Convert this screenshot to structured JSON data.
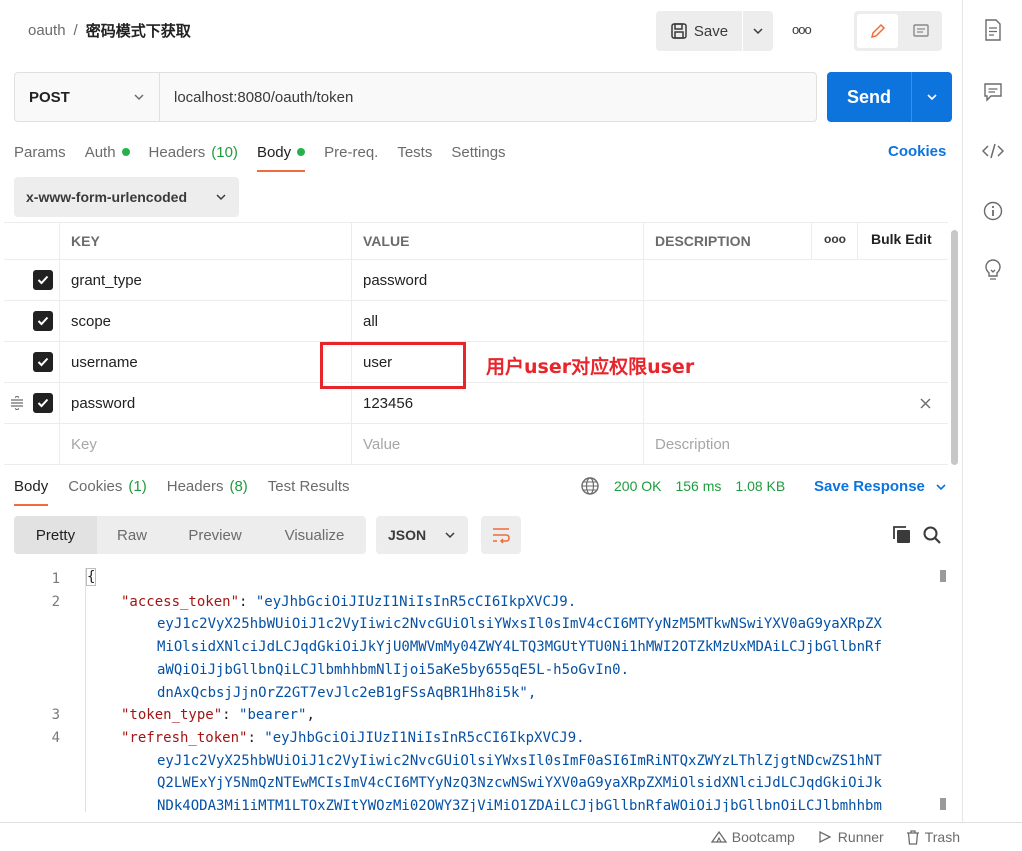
{
  "breadcrumb": {
    "collection": "oauth",
    "separator": "/",
    "request": "密码模式下获取"
  },
  "header": {
    "save_label": "Save",
    "more_label": "ooo"
  },
  "request": {
    "method": "POST",
    "url": "localhost:8080/oauth/token",
    "send_label": "Send"
  },
  "tabs": {
    "params": "Params",
    "auth": "Auth",
    "headers": "Headers",
    "headers_count": "(10)",
    "body": "Body",
    "prereq": "Pre-req.",
    "tests": "Tests",
    "settings": "Settings",
    "cookies": "Cookies"
  },
  "body_type": "x-www-form-urlencoded",
  "table": {
    "headers": {
      "key": "KEY",
      "value": "VALUE",
      "description": "DESCRIPTION",
      "more": "ooo",
      "bulk_edit": "Bulk Edit"
    },
    "rows": [
      {
        "key": "grant_type",
        "value": "password",
        "checked": true
      },
      {
        "key": "scope",
        "value": "all",
        "checked": true
      },
      {
        "key": "username",
        "value": "user",
        "checked": true
      },
      {
        "key": "password",
        "value": "123456",
        "checked": true
      }
    ],
    "placeholders": {
      "key": "Key",
      "value": "Value",
      "description": "Description"
    }
  },
  "annotation": {
    "text": "用户user对应权限user",
    "color": "#e8252b"
  },
  "response": {
    "tabs": {
      "body": "Body",
      "cookies": "Cookies",
      "cookies_count": "(1)",
      "headers": "Headers",
      "headers_count": "(8)",
      "test_results": "Test Results"
    },
    "status": "200 OK",
    "time": "156 ms",
    "size": "1.08 KB",
    "save_response": "Save Response",
    "formats": {
      "pretty": "Pretty",
      "raw": "Raw",
      "preview": "Preview",
      "visualize": "Visualize"
    },
    "lang": "JSON"
  },
  "code": {
    "line_numbers": [
      "1",
      "2",
      "3",
      "4"
    ],
    "brace": "{",
    "access_token_key": "\"access_token\"",
    "access_token_lines": [
      "\"eyJhbGciOiJIUzI1NiIsInR5cCI6IkpXVCJ9.",
      "eyJ1c2VyX25hbWUiOiJ1c2VyIiwic2NvcGUiOlsiYWxsIl0sImV4cCI6MTYyNzM5MTkwNSwiYXV0aG9yaXRpZX",
      "MiOlsidXNlciJdLCJqdGkiOiJkYjU0MWVmMy04ZWY4LTQ3MGUtYTU0Ni1hMWI2OTZkMzUxMDAiLCJjbGllbnRf",
      "aWQiOiJjbGllbnQiLCJlbmhhbmNlIjoi5aKe5by655qE5L-h5oGvIn0.",
      "dnAxQcbsjJjnOrZ2GT7evJlc2eB1gFSsAqBR1Hh8i5k\","
    ],
    "token_type_key": "\"token_type\"",
    "token_type_value": "\"bearer\"",
    "refresh_token_key": "\"refresh_token\"",
    "refresh_token_lines": [
      "\"eyJhbGciOiJIUzI1NiIsInR5cCI6IkpXVCJ9.",
      "eyJ1c2VyX25hbWUiOiJ1c2VyIiwic2NvcGUiOlsiYWxsIl0sImF0aSI6ImRiNTQxZWYzLThlZjgtNDcwZS1hNT",
      "Q2LWExYjY5NmQzNTEwMCIsImV4cCI6MTYyNzQ3NzcwNSwiYXV0aG9yaXRpZXMiOlsidXNlciJdLCJqdGkiOiJk",
      "NDk4ODA3Mi1iMTM1LTOxZWItYWOzMi02OWY3ZjViMiO1ZDAiLCJjbGllbnRfaWOiOiJjbGllbnOiLCJlbmhhbm"
    ]
  },
  "footer": {
    "bootcamp": "Bootcamp",
    "runner": "Runner",
    "trash": "Trash"
  }
}
